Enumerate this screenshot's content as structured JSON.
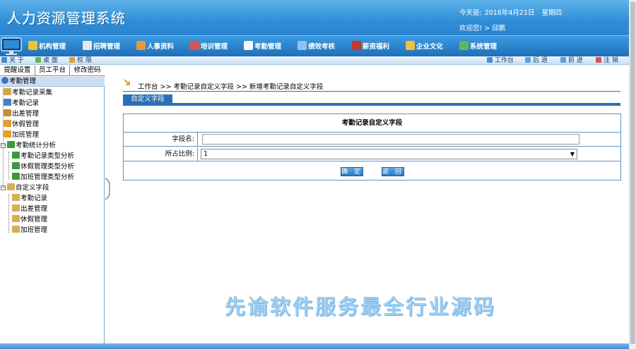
{
  "header": {
    "app_title": "人力资源管理系统",
    "today_label": "今天是:",
    "today_date": "2016年4月21日",
    "weekday": "星期四",
    "welcome": "欢迎您! > 邱鹏"
  },
  "main_nav": [
    {
      "label": "机构管理",
      "color": "#f2c230"
    },
    {
      "label": "招聘管理",
      "color": "#e8e8e8"
    },
    {
      "label": "人事资料",
      "color": "#e79a3a"
    },
    {
      "label": "培训管理",
      "color": "#d9534f"
    },
    {
      "label": "考勤管理",
      "color": "#f7f7f7"
    },
    {
      "label": "绩效考核",
      "color": "#8fc3ef"
    },
    {
      "label": "薪资福利",
      "color": "#c0392b"
    },
    {
      "label": "企业文化",
      "color": "#f0c040"
    },
    {
      "label": "系统管理",
      "color": "#5cb85c"
    }
  ],
  "sub_bar": {
    "left": [
      "关 于",
      "桌 面",
      "权 限"
    ],
    "right": [
      "工作台",
      "后 退",
      "前 进",
      "注 销"
    ]
  },
  "sidebar": {
    "tabs": [
      "提醒设置",
      "员工平台",
      "修改密码"
    ],
    "section_title": "考勤管理",
    "tree": [
      {
        "label": "考勤记录采集",
        "color": "#d4a84a"
      },
      {
        "label": "考勤记录",
        "color": "#4a7fc8"
      },
      {
        "label": "出差管理",
        "color": "#c98a3a"
      },
      {
        "label": "休假管理",
        "color": "#e0a030"
      },
      {
        "label": "加班管理",
        "color": "#e8a020"
      },
      {
        "label": "考勤统计分析",
        "color": "#3a9a3a"
      },
      {
        "label": "考勤记录类型分析",
        "color": "#3a9a3a"
      },
      {
        "label": "休假管理类型分析",
        "color": "#3a9a3a"
      },
      {
        "label": "加班管理类型分析",
        "color": "#3a9a3a"
      },
      {
        "label": "自定义字段",
        "color": "#d4b050"
      },
      {
        "label": "考勤记录",
        "color": "#d4b050"
      },
      {
        "label": "出差管理",
        "color": "#d4b050"
      },
      {
        "label": "休假管理",
        "color": "#d4b050"
      },
      {
        "label": "加班管理",
        "color": "#d4b050"
      }
    ]
  },
  "content": {
    "breadcrumb": "工作台 >> 考勤记录自定义字段 >> 新增考勤记录自定义字段",
    "tab_label": "自定义字段",
    "form_title": "考勤记录自定义字段",
    "field_name_label": "字段名:",
    "field_name_value": "",
    "ratio_label": "所占比例:",
    "ratio_value": "1",
    "confirm_label": "确 定",
    "back_label": "返 回"
  },
  "watermark": "先谕软件服务最全行业源码",
  "colors": {
    "header_blue": "#2f8ed8",
    "border_blue": "#5b93c8",
    "accent_blue": "#2a6fb6"
  }
}
